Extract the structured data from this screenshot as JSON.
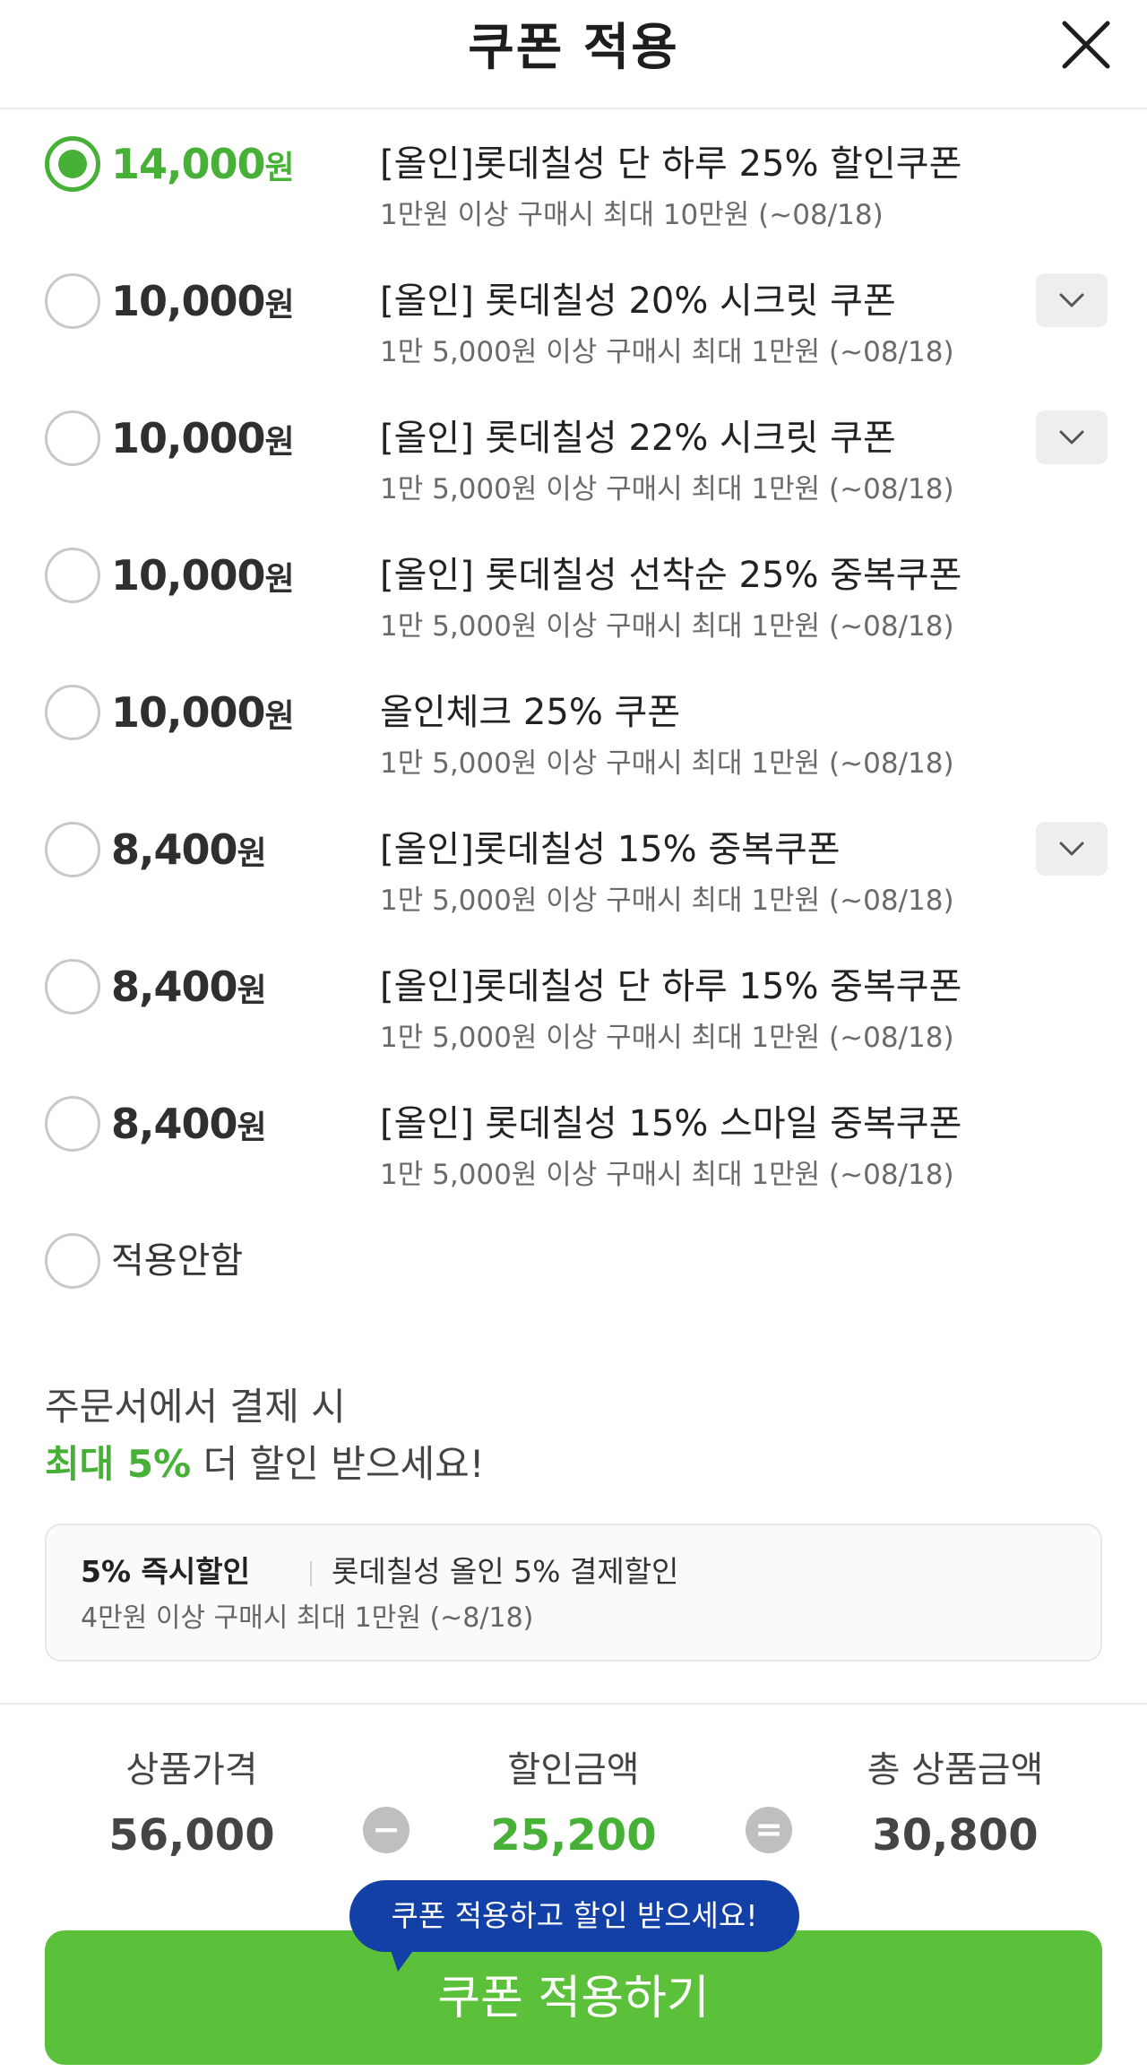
{
  "header": {
    "title": "쿠폰 적용",
    "close_icon": "close-icon"
  },
  "coupons": [
    {
      "amount": "14,000",
      "unit": "원",
      "name": "[올인]롯데칠성 단 하루 25% 할인쿠폰",
      "condition": "1만원 이상 구매시 최대 10만원 (~08/18)",
      "selected": true,
      "expandable": false
    },
    {
      "amount": "10,000",
      "unit": "원",
      "name": "[올인] 롯데칠성 20% 시크릿 쿠폰",
      "condition": "1만 5,000원 이상 구매시 최대 1만원 (~08/18)",
      "selected": false,
      "expandable": true
    },
    {
      "amount": "10,000",
      "unit": "원",
      "name": "[올인] 롯데칠성 22% 시크릿 쿠폰",
      "condition": "1만 5,000원 이상 구매시 최대 1만원 (~08/18)",
      "selected": false,
      "expandable": true
    },
    {
      "amount": "10,000",
      "unit": "원",
      "name": "[올인] 롯데칠성 선착순 25% 중복쿠폰",
      "condition": "1만 5,000원 이상 구매시 최대 1만원 (~08/18)",
      "selected": false,
      "expandable": false
    },
    {
      "amount": "10,000",
      "unit": "원",
      "name": "올인체크 25% 쿠폰",
      "condition": "1만 5,000원 이상 구매시 최대 1만원 (~08/18)",
      "selected": false,
      "expandable": false
    },
    {
      "amount": "8,400",
      "unit": "원",
      "name": "[올인]롯데칠성 15% 중복쿠폰",
      "condition": "1만 5,000원 이상 구매시 최대 1만원 (~08/18)",
      "selected": false,
      "expandable": true
    },
    {
      "amount": "8,400",
      "unit": "원",
      "name": "[올인]롯데칠성 단 하루 15% 중복쿠폰",
      "condition": "1만 5,000원 이상 구매시 최대 1만원 (~08/18)",
      "selected": false,
      "expandable": false
    },
    {
      "amount": "8,400",
      "unit": "원",
      "name": "[올인] 롯데칠성 15% 스마일 중복쿠폰",
      "condition": "1만 5,000원 이상 구매시 최대 1만원 (~08/18)",
      "selected": false,
      "expandable": false
    }
  ],
  "no_coupon": {
    "label": "적용안함"
  },
  "promo": {
    "line1": "주문서에서 결제 시",
    "highlight": "최대 5%",
    "line2_rest": " 더 할인 받으세요!"
  },
  "payment_discount": {
    "tag": "5% 즉시할인",
    "name": "롯데칠성 올인 5% 결제할인",
    "condition": "4만원 이상 구매시 최대 1만원 (~8/18)"
  },
  "summary": {
    "price_label": "상품가격",
    "price_value": "56,000",
    "minus_op": "−",
    "discount_label": "할인금액",
    "discount_value": "25,200",
    "equals_op": "=",
    "total_label": "총 상품금액",
    "total_value": "30,800"
  },
  "tooltip": {
    "text": "쿠폰 적용하고 할인 받으세요!"
  },
  "cta": {
    "label": "쿠폰 적용하기"
  },
  "colors": {
    "accent_green": "#46b037",
    "button_green": "#5cc13a",
    "tooltip_blue": "#1340a6"
  }
}
